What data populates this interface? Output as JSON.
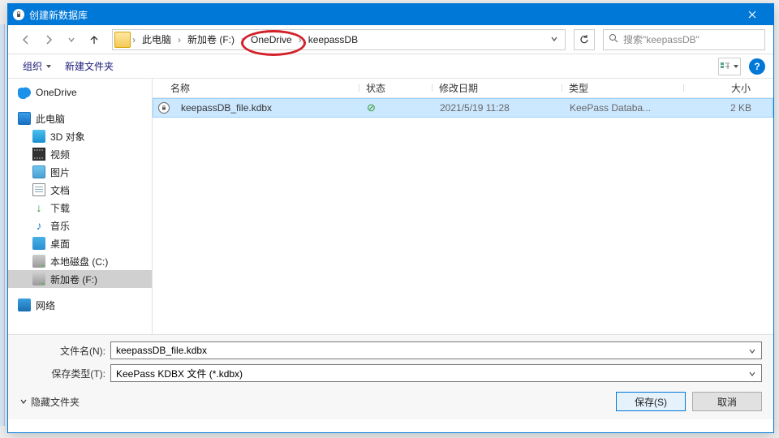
{
  "window": {
    "title": "创建新数据库"
  },
  "nav": {
    "crumbs": [
      "此电脑",
      "新加卷 (F:)",
      "OneDrive",
      "keepassDB"
    ],
    "search_placeholder": "搜索\"keepassDB\""
  },
  "toolbar": {
    "organize": "组织",
    "newfolder": "新建文件夹"
  },
  "sidebar": {
    "onedrive": "OneDrive",
    "thispc": "此电脑",
    "items": [
      {
        "label": "3D 对象"
      },
      {
        "label": "视频"
      },
      {
        "label": "图片"
      },
      {
        "label": "文档"
      },
      {
        "label": "下载"
      },
      {
        "label": "音乐"
      },
      {
        "label": "桌面"
      },
      {
        "label": "本地磁盘 (C:)"
      },
      {
        "label": "新加卷 (F:)"
      }
    ],
    "network": "网络"
  },
  "columns": {
    "name": "名称",
    "status": "状态",
    "date": "修改日期",
    "type": "类型",
    "size": "大小"
  },
  "files": [
    {
      "name": "keepassDB_file.kdbx",
      "status": "ok",
      "date": "2021/5/19 11:28",
      "type": "KeePass Databa...",
      "size": "2 KB"
    }
  ],
  "footer": {
    "filename_label": "文件名(N):",
    "filename_value": "keepassDB_file.kdbx",
    "filetype_label": "保存类型(T):",
    "filetype_value": "KeePass KDBX 文件 (*.kdbx)",
    "hide_folders": "隐藏文件夹",
    "save": "保存(S)",
    "cancel": "取消"
  }
}
